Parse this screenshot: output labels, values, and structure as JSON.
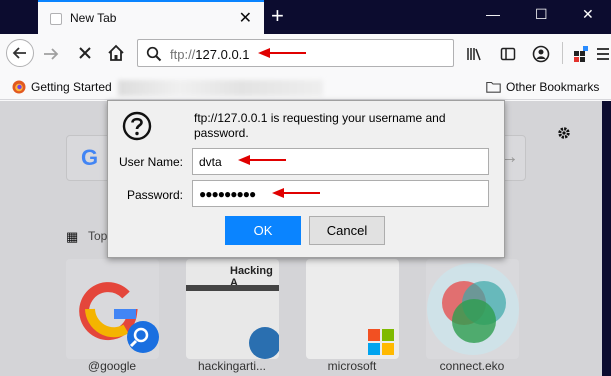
{
  "tab": {
    "title": "New Tab",
    "close_icon": "close-icon"
  },
  "window": {
    "minimize": "minimize-icon",
    "maximize": "maximize-icon",
    "close": "close-icon"
  },
  "navbar": {
    "url_protocol": "ftp://",
    "url_host": "127.0.0.1"
  },
  "bookmarks": {
    "first": "Getting Started",
    "other": "Other Bookmarks"
  },
  "dialog": {
    "message": "ftp://127.0.0.1 is requesting your username and password.",
    "username_label": "User Name:",
    "username_value": "dvta",
    "password_label": "Password:",
    "password_value": "●●●●●●●●●",
    "ok_label": "OK",
    "cancel_label": "Cancel"
  },
  "newtab": {
    "top_sites_heading": "Top",
    "tiles": [
      "@google",
      "hackingarti...",
      "microsoft",
      "connect.eko"
    ]
  },
  "colors": {
    "accent": "#0a84ff",
    "annotation_arrow": "#e00000",
    "titlebar": "#0c0c2f"
  }
}
